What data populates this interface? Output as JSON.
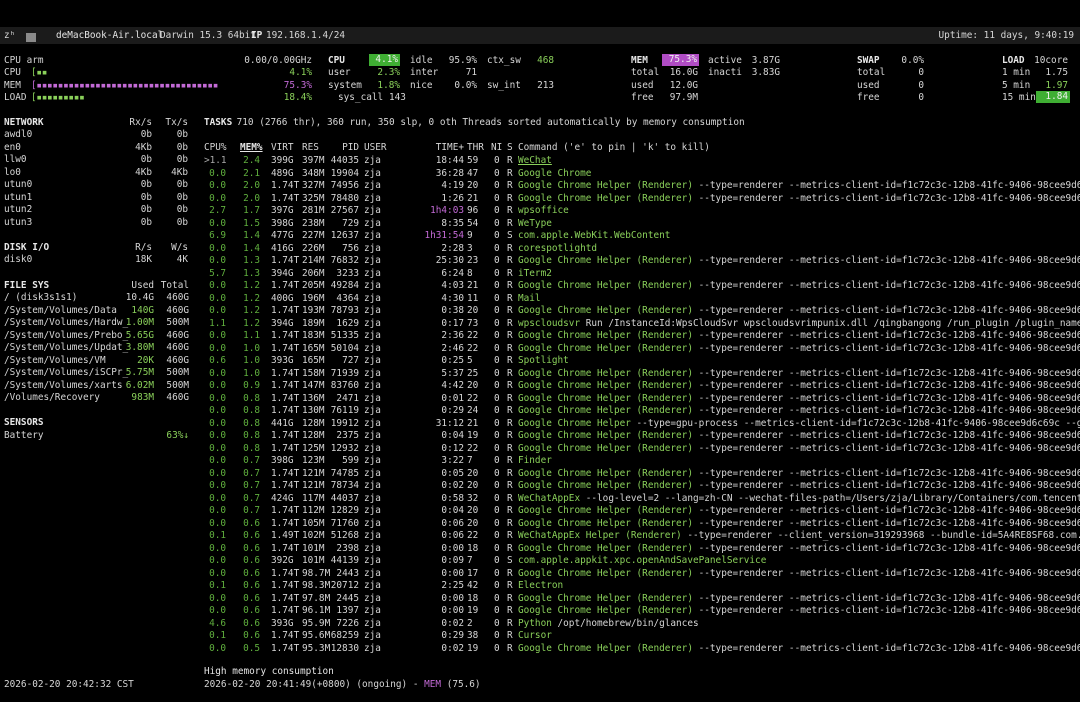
{
  "topbar": {
    "hostname_prefix": "zʰ",
    "hostname": "deMacBook-Air.local",
    "os": "Darwin 15.3 64bit",
    "ip_label": "IP",
    "ip": "192.168.1.4/24",
    "uptime": "Uptime: 11 days, 9:40:19"
  },
  "quicklook": {
    "cpu_name": "CPU arm",
    "cpu_freq": "0.00/0.00GHz",
    "rows": [
      {
        "label": "CPU",
        "bar": "[▪▪",
        "value": "4.1%"
      },
      {
        "label": "MEM",
        "bar": "[▪▪▪▪▪▪▪▪▪▪▪▪▪▪▪▪▪▪▪▪▪▪▪▪▪▪▪▪▪▪▪▪▪▪",
        "value": "75.3%"
      },
      {
        "label": "LOAD",
        "bar": "[▪▪▪▪▪▪▪▪▪",
        "value": "18.4%"
      }
    ]
  },
  "cpu": {
    "title": "CPU",
    "total": "4.1%",
    "user_label": "user",
    "user": "2.3%",
    "system_label": "system",
    "system": "1.8%",
    "idle_label": "idle",
    "idle": "95.9%",
    "inter_label": "inter",
    "inter": "71",
    "nice_label": "nice",
    "nice": "0.0%",
    "syscall_label": "sys_call",
    "syscall": "143",
    "ctxsw_label": "ctx_sw",
    "ctxsw": "468",
    "swint_label": "sw_int",
    "swint": "213"
  },
  "mem": {
    "title": "MEM",
    "percent": "75.3%",
    "total_label": "total",
    "total": "16.0G",
    "used_label": "used",
    "used": "12.0G",
    "free_label": "free",
    "free": "97.9M",
    "active_label": "active",
    "active": "3.87G",
    "inacti_label": "inacti",
    "inacti": "3.83G"
  },
  "swap": {
    "title": "SWAP",
    "percent": "0.0%",
    "total_label": "total",
    "total": "0",
    "used_label": "used",
    "used": "0",
    "free_label": "free",
    "free": "0"
  },
  "load": {
    "title": "LOAD",
    "cores": "10core",
    "m1_label": "1 min",
    "m1": "1.75",
    "m5_label": "5 min",
    "m5": "1.97",
    "m15_label": "15 min",
    "m15": "1.84"
  },
  "network": {
    "title": "NETWORK",
    "rx": "Rx/s",
    "tx": "Tx/s",
    "rows": [
      {
        "name": "awdl0",
        "rx": "0b",
        "tx": "0b"
      },
      {
        "name": "en0",
        "rx": "4Kb",
        "tx": "0b"
      },
      {
        "name": "llw0",
        "rx": "0b",
        "tx": "0b"
      },
      {
        "name": "lo0",
        "rx": "4Kb",
        "tx": "4Kb"
      },
      {
        "name": "utun0",
        "rx": "0b",
        "tx": "0b"
      },
      {
        "name": "utun1",
        "rx": "0b",
        "tx": "0b"
      },
      {
        "name": "utun2",
        "rx": "0b",
        "tx": "0b"
      },
      {
        "name": "utun3",
        "rx": "0b",
        "tx": "0b"
      }
    ]
  },
  "diskio": {
    "title": "DISK I/O",
    "r": "R/s",
    "w": "W/s",
    "rows": [
      {
        "name": "disk0",
        "r": "18K",
        "w": "4K"
      }
    ]
  },
  "filesys": {
    "title": "FILE SYS",
    "used": "Used",
    "total": "Total",
    "rows": [
      {
        "name": "/ (disk3s1s1)",
        "used": "10.4G",
        "total": "460G",
        "hl": false
      },
      {
        "name": "/System/Volumes/Data",
        "used": "140G",
        "total": "460G",
        "hl": true
      },
      {
        "name": "/System/Volumes/Hardw_",
        "used": "1.00M",
        "total": "500M",
        "hl": true
      },
      {
        "name": "/System/Volumes/Prebo_",
        "used": "5.65G",
        "total": "460G",
        "hl": true
      },
      {
        "name": "/System/Volumes/Updat_",
        "used": "3.80M",
        "total": "460G",
        "hl": true
      },
      {
        "name": "/System/Volumes/VM",
        "used": "20K",
        "total": "460G",
        "hl": true
      },
      {
        "name": "/System/Volumes/iSCPr_",
        "used": "5.75M",
        "total": "500M",
        "hl": true
      },
      {
        "name": "/System/Volumes/xarts",
        "used": "6.02M",
        "total": "500M",
        "hl": true
      },
      {
        "name": "/Volumes/Recovery",
        "used": "983M",
        "total": "460G",
        "hl": true
      }
    ]
  },
  "sensors": {
    "title": "SENSORS",
    "label": "Battery",
    "value": "63%↓"
  },
  "tasks": {
    "label": "TASKS",
    "summary": " 710 (2766 thr), 360 run, 350 slp, 0 oth Threads sorted automatically by memory consumption"
  },
  "proc_headers": {
    "cpu": "CPU%",
    "mem": "MEM%",
    "virt": "VIRT",
    "res": "RES",
    "pid": "PID",
    "user": "USER",
    "time": "TIME+",
    "thr": "THR",
    "ni": "NI",
    "s": "S",
    "cmd": "Command ('e' to pin | 'k' to kill)"
  },
  "processes": [
    {
      "cpu": ">1.1",
      "mem": "2.4",
      "virt": "399G",
      "res": "397M",
      "pid": "44035",
      "user": "zja",
      "time": "18:44",
      "thr": "59",
      "ni": "0",
      "s": "R",
      "name": "WeChat",
      "args": "",
      "name_u": true,
      "time_m": false
    },
    {
      "cpu": "0.0",
      "mem": "2.1",
      "virt": "489G",
      "res": "348M",
      "pid": "19904",
      "user": "zja",
      "time": "36:28",
      "thr": "47",
      "ni": "0",
      "s": "R",
      "name": "Google Chrome",
      "args": "",
      "time_m": false
    },
    {
      "cpu": "0.0",
      "mem": "2.0",
      "virt": "1.74T",
      "res": "327M",
      "pid": "74956",
      "user": "zja",
      "time": "4:19",
      "thr": "20",
      "ni": "0",
      "s": "R",
      "name": "Google Chrome Helper (Renderer)",
      "args": " --type=renderer --metrics-client-id=f1c72c3c-12b8-41fc-9406-98cee9d6c69c --o",
      "time_m": false
    },
    {
      "cpu": "0.0",
      "mem": "2.0",
      "virt": "1.74T",
      "res": "325M",
      "pid": "78480",
      "user": "zja",
      "time": "1:26",
      "thr": "21",
      "ni": "0",
      "s": "R",
      "name": "Google Chrome Helper (Renderer)",
      "args": " --type=renderer --metrics-client-id=f1c72c3c-12b8-41fc-9406-98cee9d6c69c --o",
      "time_m": false
    },
    {
      "cpu": "2.7",
      "mem": "1.7",
      "virt": "397G",
      "res": "281M",
      "pid": "27567",
      "user": "zja",
      "time": "1h4:03",
      "thr": "96",
      "ni": "0",
      "s": "R",
      "name": "wpsoffice",
      "args": "",
      "time_m": true
    },
    {
      "cpu": "0.0",
      "mem": "1.5",
      "virt": "398G",
      "res": "238M",
      "pid": "729",
      "user": "zja",
      "time": "8:35",
      "thr": "54",
      "ni": "0",
      "s": "R",
      "name": "WeType",
      "args": "",
      "time_m": false
    },
    {
      "cpu": "6.9",
      "mem": "1.4",
      "virt": "477G",
      "res": "227M",
      "pid": "12637",
      "user": "zja",
      "time": "1h31:54",
      "thr": "9",
      "ni": "0",
      "s": "S",
      "name": "com.apple.WebKit.WebContent",
      "args": "",
      "time_m": true
    },
    {
      "cpu": "0.0",
      "mem": "1.4",
      "virt": "416G",
      "res": "226M",
      "pid": "756",
      "user": "zja",
      "time": "2:28",
      "thr": "3",
      "ni": "0",
      "s": "R",
      "name": "corespotlightd",
      "args": "",
      "time_m": false
    },
    {
      "cpu": "0.0",
      "mem": "1.3",
      "virt": "1.74T",
      "res": "214M",
      "pid": "76832",
      "user": "zja",
      "time": "25:30",
      "thr": "23",
      "ni": "0",
      "s": "R",
      "name": "Google Chrome Helper (Renderer)",
      "args": " --type=renderer --metrics-client-id=f1c72c3c-12b8-41fc-9406-98cee9d6c69c --o",
      "time_m": false
    },
    {
      "cpu": "5.7",
      "mem": "1.3",
      "virt": "394G",
      "res": "206M",
      "pid": "3233",
      "user": "zja",
      "time": "6:24",
      "thr": "8",
      "ni": "0",
      "s": "R",
      "name": "iTerm2",
      "args": "",
      "time_m": false
    },
    {
      "cpu": "0.0",
      "mem": "1.2",
      "virt": "1.74T",
      "res": "205M",
      "pid": "49284",
      "user": "zja",
      "time": "4:03",
      "thr": "21",
      "ni": "0",
      "s": "R",
      "name": "Google Chrome Helper (Renderer)",
      "args": " --type=renderer --metrics-client-id=f1c72c3c-12b8-41fc-9406-98cee9d6c69c --o",
      "time_m": false
    },
    {
      "cpu": "0.0",
      "mem": "1.2",
      "virt": "400G",
      "res": "196M",
      "pid": "4364",
      "user": "zja",
      "time": "4:30",
      "thr": "11",
      "ni": "0",
      "s": "R",
      "name": "Mail",
      "args": "",
      "time_m": false
    },
    {
      "cpu": "0.0",
      "mem": "1.2",
      "virt": "1.74T",
      "res": "193M",
      "pid": "78793",
      "user": "zja",
      "time": "0:38",
      "thr": "20",
      "ni": "0",
      "s": "R",
      "name": "Google Chrome Helper (Renderer)",
      "args": " --type=renderer --metrics-client-id=f1c72c3c-12b8-41fc-9406-98cee9d6c69c --o",
      "time_m": false
    },
    {
      "cpu": "1.1",
      "mem": "1.2",
      "virt": "394G",
      "res": "189M",
      "pid": "1629",
      "user": "zja",
      "time": "0:17",
      "thr": "73",
      "ni": "0",
      "s": "R",
      "name": "wpscloudsvr",
      "args": " Run /InstanceId:WpsCloudSvr wpscloudsvrimpunix.dll /qingbangong /run_plugin /plugin_name=qing /p",
      "time_m": false
    },
    {
      "cpu": "0.0",
      "mem": "1.1",
      "virt": "1.74T",
      "res": "183M",
      "pid": "51335",
      "user": "zja",
      "time": "2:36",
      "thr": "22",
      "ni": "0",
      "s": "R",
      "name": "Google Chrome Helper (Renderer)",
      "args": " --type=renderer --metrics-client-id=f1c72c3c-12b8-41fc-9406-98cee9d6c69c --o",
      "time_m": false
    },
    {
      "cpu": "0.0",
      "mem": "1.0",
      "virt": "1.74T",
      "res": "165M",
      "pid": "50104",
      "user": "zja",
      "time": "2:46",
      "thr": "22",
      "ni": "0",
      "s": "R",
      "name": "Google Chrome Helper (Renderer)",
      "args": " --type=renderer --metrics-client-id=f1c72c3c-12b8-41fc-9406-98cee9d6c69c --o",
      "time_m": false
    },
    {
      "cpu": "0.6",
      "mem": "1.0",
      "virt": "393G",
      "res": "165M",
      "pid": "727",
      "user": "zja",
      "time": "0:25",
      "thr": "5",
      "ni": "0",
      "s": "R",
      "name": "Spotlight",
      "args": "",
      "time_m": false
    },
    {
      "cpu": "0.0",
      "mem": "1.0",
      "virt": "1.74T",
      "res": "158M",
      "pid": "71939",
      "user": "zja",
      "time": "5:37",
      "thr": "25",
      "ni": "0",
      "s": "R",
      "name": "Google Chrome Helper (Renderer)",
      "args": " --type=renderer --metrics-client-id=f1c72c3c-12b8-41fc-9406-98cee9d6c69c --o",
      "time_m": false
    },
    {
      "cpu": "0.0",
      "mem": "0.9",
      "virt": "1.74T",
      "res": "147M",
      "pid": "83760",
      "user": "zja",
      "time": "4:42",
      "thr": "20",
      "ni": "0",
      "s": "R",
      "name": "Google Chrome Helper (Renderer)",
      "args": " --type=renderer --metrics-client-id=f1c72c3c-12b8-41fc-9406-98cee9d6c69c --o",
      "time_m": false
    },
    {
      "cpu": "0.0",
      "mem": "0.8",
      "virt": "1.74T",
      "res": "136M",
      "pid": "2471",
      "user": "zja",
      "time": "0:01",
      "thr": "22",
      "ni": "0",
      "s": "R",
      "name": "Google Chrome Helper (Renderer)",
      "args": " --type=renderer --metrics-client-id=f1c72c3c-12b8-41fc-9406-98cee9d6c69c --o",
      "time_m": false
    },
    {
      "cpu": "0.0",
      "mem": "0.8",
      "virt": "1.74T",
      "res": "130M",
      "pid": "76119",
      "user": "zja",
      "time": "0:29",
      "thr": "24",
      "ni": "0",
      "s": "R",
      "name": "Google Chrome Helper (Renderer)",
      "args": " --type=renderer --metrics-client-id=f1c72c3c-12b8-41fc-9406-98cee9d6c69c --o",
      "time_m": false
    },
    {
      "cpu": "0.0",
      "mem": "0.8",
      "virt": "441G",
      "res": "128M",
      "pid": "19912",
      "user": "zja",
      "time": "31:12",
      "thr": "21",
      "ni": "0",
      "s": "R",
      "name": "Google Chrome Helper",
      "args": " --type=gpu-process --metrics-client-id=f1c72c3c-12b8-41fc-9406-98cee9d6c69c --gpu-prefe",
      "time_m": false
    },
    {
      "cpu": "0.0",
      "mem": "0.8",
      "virt": "1.74T",
      "res": "128M",
      "pid": "2375",
      "user": "zja",
      "time": "0:04",
      "thr": "19",
      "ni": "0",
      "s": "R",
      "name": "Google Chrome Helper (Renderer)",
      "args": " --type=renderer --metrics-client-id=f1c72c3c-12b8-41fc-9406-98cee9d6c69c --o",
      "time_m": false
    },
    {
      "cpu": "0.0",
      "mem": "0.8",
      "virt": "1.74T",
      "res": "125M",
      "pid": "12932",
      "user": "zja",
      "time": "0:12",
      "thr": "22",
      "ni": "0",
      "s": "R",
      "name": "Google Chrome Helper (Renderer)",
      "args": " --type=renderer --metrics-client-id=f1c72c3c-12b8-41fc-9406-98cee9d6c69c --o",
      "time_m": false
    },
    {
      "cpu": "0.0",
      "mem": "0.7",
      "virt": "398G",
      "res": "123M",
      "pid": "599",
      "user": "zja",
      "time": "3:22",
      "thr": "7",
      "ni": "0",
      "s": "R",
      "name": "Finder",
      "args": "",
      "time_m": false
    },
    {
      "cpu": "0.0",
      "mem": "0.7",
      "virt": "1.74T",
      "res": "121M",
      "pid": "74785",
      "user": "zja",
      "time": "0:05",
      "thr": "20",
      "ni": "0",
      "s": "R",
      "name": "Google Chrome Helper (Renderer)",
      "args": " --type=renderer --metrics-client-id=f1c72c3c-12b8-41fc-9406-98cee9d6c69c --o",
      "time_m": false
    },
    {
      "cpu": "0.0",
      "mem": "0.7",
      "virt": "1.74T",
      "res": "121M",
      "pid": "78734",
      "user": "zja",
      "time": "0:02",
      "thr": "20",
      "ni": "0",
      "s": "R",
      "name": "Google Chrome Helper (Renderer)",
      "args": " --type=renderer --metrics-client-id=f1c72c3c-12b8-41fc-9406-98cee9d6c69c --o",
      "time_m": false
    },
    {
      "cpu": "0.0",
      "mem": "0.7",
      "virt": "424G",
      "res": "117M",
      "pid": "44037",
      "user": "zja",
      "time": "0:58",
      "thr": "32",
      "ni": "0",
      "s": "R",
      "name": "WeChatAppEx",
      "args": " --log-level=2 --lang=zh-CN --wechat-files-path=/Users/zja/Library/Containers/com.tencent.xinWeCh",
      "time_m": false
    },
    {
      "cpu": "0.0",
      "mem": "0.7",
      "virt": "1.74T",
      "res": "112M",
      "pid": "12829",
      "user": "zja",
      "time": "0:04",
      "thr": "20",
      "ni": "0",
      "s": "R",
      "name": "Google Chrome Helper (Renderer)",
      "args": " --type=renderer --metrics-client-id=f1c72c3c-12b8-41fc-9406-98cee9d6c69c --o",
      "time_m": false
    },
    {
      "cpu": "0.0",
      "mem": "0.6",
      "virt": "1.74T",
      "res": "105M",
      "pid": "71760",
      "user": "zja",
      "time": "0:06",
      "thr": "20",
      "ni": "0",
      "s": "R",
      "name": "Google Chrome Helper (Renderer)",
      "args": " --type=renderer --metrics-client-id=f1c72c3c-12b8-41fc-9406-98cee9d6c69c --o",
      "time_m": false
    },
    {
      "cpu": "0.1",
      "mem": "0.6",
      "virt": "1.49T",
      "res": "102M",
      "pid": "51268",
      "user": "zja",
      "time": "0:06",
      "thr": "22",
      "ni": "0",
      "s": "R",
      "name": "WeChatAppEx Helper (Renderer)",
      "args": " --type=renderer --client_version=319293968 --bundle-id=5A4RE8SF68.com.tencent.",
      "time_m": false
    },
    {
      "cpu": "0.0",
      "mem": "0.6",
      "virt": "1.74T",
      "res": "101M",
      "pid": "2398",
      "user": "zja",
      "time": "0:00",
      "thr": "18",
      "ni": "0",
      "s": "R",
      "name": "Google Chrome Helper (Renderer)",
      "args": " --type=renderer --metrics-client-id=f1c72c3c-12b8-41fc-9406-98cee9d6c69c --o",
      "time_m": false
    },
    {
      "cpu": "0.0",
      "mem": "0.6",
      "virt": "392G",
      "res": "101M",
      "pid": "44139",
      "user": "zja",
      "time": "0:09",
      "thr": "7",
      "ni": "0",
      "s": "S",
      "name": "com.apple.appkit.xpc.openAndSavePanelService",
      "args": "",
      "time_m": false
    },
    {
      "cpu": "0.0",
      "mem": "0.6",
      "virt": "1.74T",
      "res": "98.7M",
      "pid": "2443",
      "user": "zja",
      "time": "0:00",
      "thr": "17",
      "ni": "0",
      "s": "R",
      "name": "Google Chrome Helper (Renderer)",
      "args": " --type=renderer --metrics-client-id=f1c72c3c-12b8-41fc-9406-98cee9d6c69c --o",
      "time_m": false
    },
    {
      "cpu": "0.1",
      "mem": "0.6",
      "virt": "1.74T",
      "res": "98.3M",
      "pid": "20712",
      "user": "zja",
      "time": "2:25",
      "thr": "42",
      "ni": "0",
      "s": "R",
      "name": "Electron",
      "args": "",
      "time_m": false
    },
    {
      "cpu": "0.0",
      "mem": "0.6",
      "virt": "1.74T",
      "res": "97.8M",
      "pid": "2445",
      "user": "zja",
      "time": "0:00",
      "thr": "18",
      "ni": "0",
      "s": "R",
      "name": "Google Chrome Helper (Renderer)",
      "args": " --type=renderer --metrics-client-id=f1c72c3c-12b8-41fc-9406-98cee9d6c69c --o",
      "time_m": false
    },
    {
      "cpu": "0.0",
      "mem": "0.6",
      "virt": "1.74T",
      "res": "96.1M",
      "pid": "1397",
      "user": "zja",
      "time": "0:00",
      "thr": "19",
      "ni": "0",
      "s": "R",
      "name": "Google Chrome Helper (Renderer)",
      "args": " --type=renderer --metrics-client-id=f1c72c3c-12b8-41fc-9406-98cee9d6c69c --o",
      "time_m": false
    },
    {
      "cpu": "4.6",
      "mem": "0.6",
      "virt": "393G",
      "res": "95.9M",
      "pid": "7226",
      "user": "zja",
      "time": "0:02",
      "thr": "2",
      "ni": "0",
      "s": "R",
      "name": "Python",
      "args": " /opt/homebrew/bin/glances",
      "time_m": false
    },
    {
      "cpu": "0.1",
      "mem": "0.6",
      "virt": "1.74T",
      "res": "95.6M",
      "pid": "68259",
      "user": "zja",
      "time": "0:29",
      "thr": "38",
      "ni": "0",
      "s": "R",
      "name": "Cursor",
      "args": "",
      "time_m": false
    },
    {
      "cpu": "0.0",
      "mem": "0.5",
      "virt": "1.74T",
      "res": "95.3M",
      "pid": "12830",
      "user": "zja",
      "time": "0:02",
      "thr": "19",
      "ni": "0",
      "s": "R",
      "name": "Google Chrome Helper (Renderer)",
      "args": " --type=renderer --metrics-client-id=f1c72c3c-12b8-41fc-9406-98cee9d6c69c --o",
      "time_m": false
    }
  ],
  "alert": {
    "title": "High memory consumption",
    "time": "2026-02-20 20:41:49(+0800) (ongoing) - ",
    "type": "MEM",
    "value": " (75.6)"
  },
  "footer": {
    "clock": "2026-02-20 20:42:32 CST"
  },
  "colors": {
    "ok": "#8ad05a",
    "careful": "#3fae33",
    "warning": "#b04cc4",
    "bg": "#000000"
  }
}
